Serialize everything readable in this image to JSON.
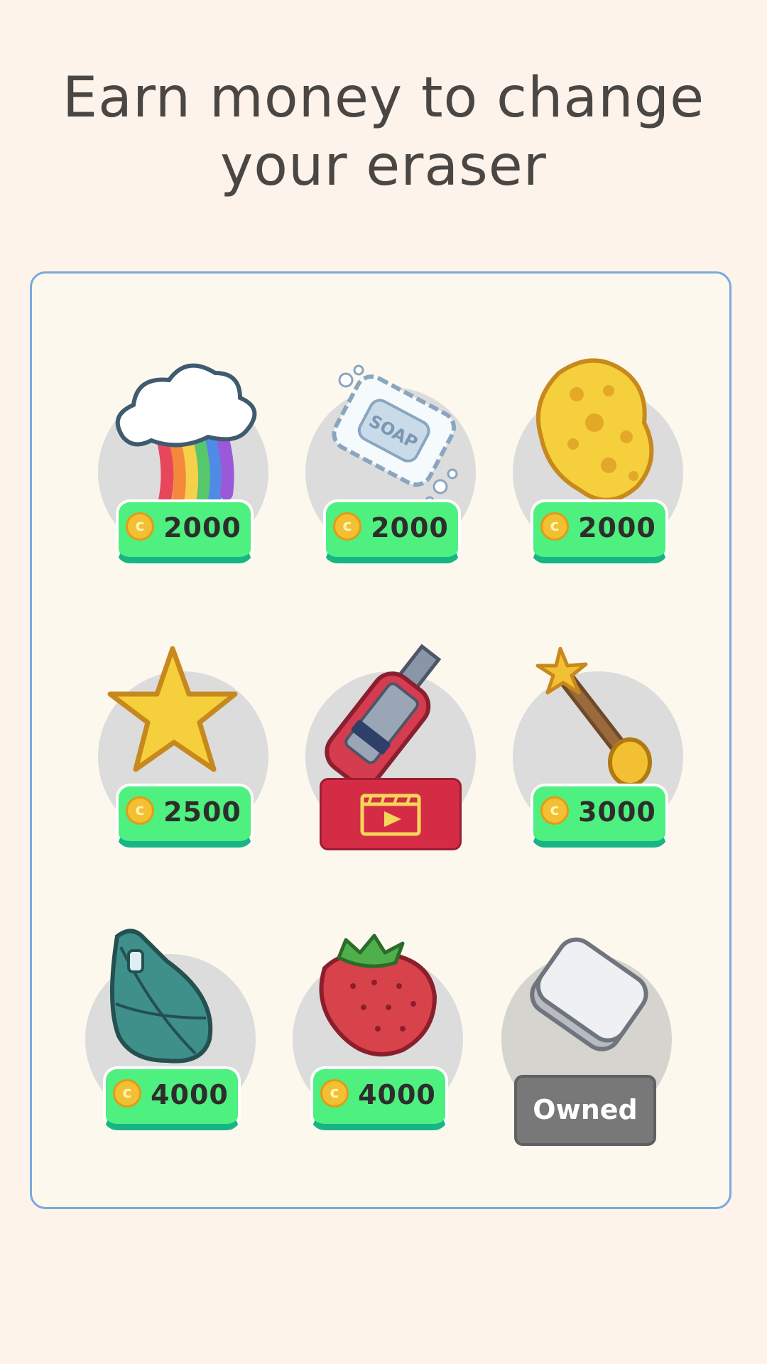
{
  "header": {
    "title_line1": "Earn money to change",
    "title_line2": "your eraser"
  },
  "shop": {
    "items": [
      {
        "name": "Rainbow cloud",
        "icon": "rainbow-cloud-icon",
        "status": "price",
        "price": "2000"
      },
      {
        "name": "Soap",
        "icon": "soap-icon",
        "status": "price",
        "price": "2000"
      },
      {
        "name": "Sponge",
        "icon": "sponge-icon",
        "status": "price",
        "price": "2000"
      },
      {
        "name": "Star",
        "icon": "star-icon",
        "status": "price",
        "price": "2500"
      },
      {
        "name": "Utility knife",
        "icon": "utility-knife-icon",
        "status": "watch-ad",
        "action_icon": "video-play-icon"
      },
      {
        "name": "Magic wand",
        "icon": "magic-wand-icon",
        "status": "price",
        "price": "3000"
      },
      {
        "name": "Bag",
        "icon": "bag-icon",
        "status": "price",
        "price": "4000"
      },
      {
        "name": "Strawberry",
        "icon": "strawberry-icon",
        "status": "price",
        "price": "4000"
      },
      {
        "name": "Eraser",
        "icon": "eraser-icon",
        "status": "owned",
        "owned_label": "Owned"
      }
    ]
  },
  "colors": {
    "background": "#fdf3ea",
    "panel": "#fdf8ee",
    "panel_border": "#7aa9de",
    "price_button": "#4ef07f",
    "price_button_shadow": "#17b586",
    "ad_button": "#d42c45",
    "owned_button": "#787878",
    "coin": "#f3c033"
  }
}
